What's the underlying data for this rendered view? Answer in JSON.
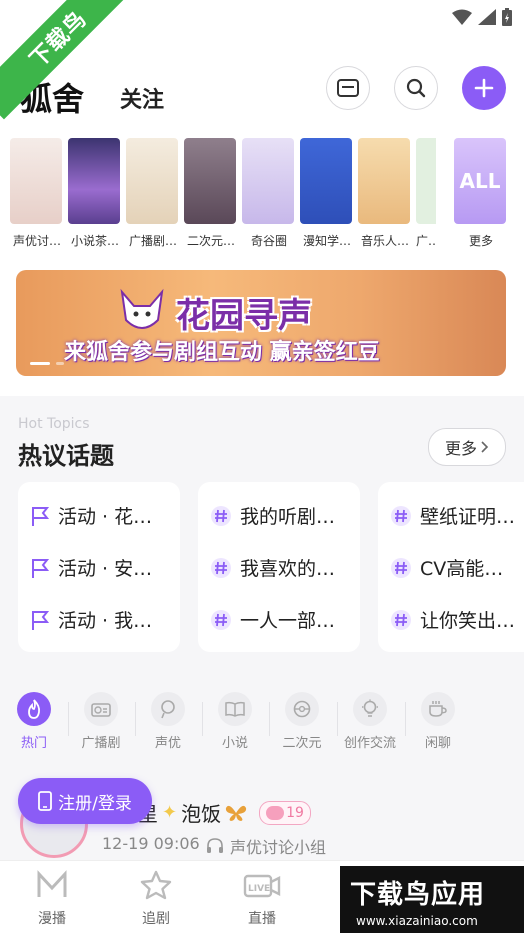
{
  "watermark": {
    "ribbon": "下载鸟",
    "ad_big": "下载鸟应用",
    "ad_url": "www.xiazainiao.com"
  },
  "header": {
    "title": "狐舍",
    "follow_tab": "关注"
  },
  "categories": [
    {
      "label": "声优讨…",
      "color": "#f1e4e0"
    },
    {
      "label": "小说茶…",
      "color": "#5b4a8f"
    },
    {
      "label": "广播剧…",
      "color": "#efe5d5"
    },
    {
      "label": "二次元…",
      "color": "#7a6a78"
    },
    {
      "label": "奇谷圈",
      "color": "#d9d0f0"
    },
    {
      "label": "漫知学…",
      "color": "#3f67d8"
    },
    {
      "label": "音乐人…",
      "color": "#f3d6a2"
    },
    {
      "label": "广…",
      "color": "#e2f0e0"
    },
    {
      "label": "更多",
      "thumb_text": "ALL",
      "color": "#c9b3f5"
    }
  ],
  "banner": {
    "title": "花园寻声",
    "subtitle": "来狐舍参与剧组互动 赢亲签红豆"
  },
  "hot_topics": {
    "title_en": "Hot Topics",
    "title": "热议话题",
    "more": "更多",
    "columns": [
      {
        "icon": "flag-icon",
        "items": [
          "活动 · 花…",
          "活动 · 安…",
          "活动 · 我…"
        ]
      },
      {
        "icon": "hashtag-icon",
        "items": [
          "我的听剧…",
          "我喜欢的…",
          "一人一部…"
        ]
      },
      {
        "icon": "hashtag-icon",
        "items": [
          "壁纸证明…",
          "CV高能…",
          "让你笑出…"
        ]
      }
    ]
  },
  "channel_tabs": [
    {
      "label": "热门",
      "icon": "fire-icon",
      "active": true
    },
    {
      "label": "广播剧",
      "icon": "radio-icon"
    },
    {
      "label": "声优",
      "icon": "microphone-icon"
    },
    {
      "label": "小说",
      "icon": "book-icon"
    },
    {
      "label": "二次元",
      "icon": "pokeball-icon"
    },
    {
      "label": "创作交流",
      "icon": "lightbulb-icon"
    },
    {
      "label": "闲聊",
      "icon": "coffee-icon"
    }
  ],
  "post": {
    "name_part1": "星",
    "name_part2": "泡饭",
    "level": "19",
    "time": "12-19 09:06",
    "group": "声优讨论小组"
  },
  "login_button": "注册/登录",
  "bottom_nav": [
    {
      "label": "漫播",
      "icon": "m-logo-icon"
    },
    {
      "label": "追剧",
      "icon": "star-icon"
    },
    {
      "label": "直播",
      "icon": "live-icon"
    }
  ],
  "colors": {
    "accent": "#8b5cf6",
    "watermark_green": "#3db54a"
  }
}
